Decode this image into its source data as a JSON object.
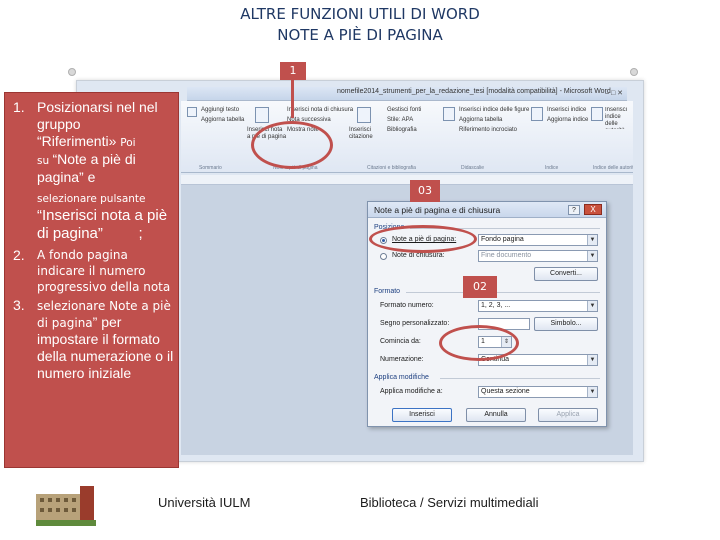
{
  "slide": {
    "title_line1": "ALTRE FUNZIONI UTILI DI WORD",
    "title_line2": "NOTE A PIÈ DI PAGINA"
  },
  "callouts": {
    "c1": "1",
    "c2": "02",
    "c3": "03"
  },
  "steps": [
    {
      "num": "1.",
      "p1": "Posizionarsi nel nel gruppo",
      "p2": "“Riferimenti» ",
      "p2b": "Poi",
      "p3a": "su ",
      "p3b": "“Note a piè di pagina” e",
      "p4a": "selezionare pulsante ",
      "p4b": "“Inserisci nota a piè di pagina”",
      "p4c": ";"
    },
    {
      "num": "2.",
      "p1": "A fondo pagina indicare il numero progressivo della nota"
    },
    {
      "num": "3.",
      "p1a": "selezionare Note a piè di pagina",
      "p1b": "” per impostare il formato della numerazione o il numero iniziale"
    }
  ],
  "word": {
    "title": "nomefile2014_strumenti_per_la_redazione_tesi [modalità compatibilità] - Microsoft Word",
    "ribbon": {
      "items": [
        "Aggiungi testo",
        "Aggiorna tabella",
        "Inserisci nota di chiusura",
        "Nota successiva",
        "Mostra note",
        "Inserisci citazione",
        "Gestisci fonti",
        "Stile: APA",
        "Bibliografia",
        "Inserisci didascalia",
        "Inserisci indice delle figure",
        "Aggiorna tabella",
        "Riferimento incrociato",
        "Contrassegna voce",
        "Inserisci indice",
        "Aggiorna indice",
        "Contrassegna citazione",
        "Inserisci indice delle autorità"
      ],
      "big_buttons": [
        "Inserisci nota a piè di pagina",
        "Inserisci citazione"
      ],
      "groups": [
        "Sommario",
        "Note a piè di pagina",
        "Citazioni e bibliografia",
        "Didascalie",
        "Indice",
        "Indice delle autorità"
      ]
    }
  },
  "dialog": {
    "title": "Note a piè di pagina e di chiusura",
    "help": "?",
    "close": "X",
    "position_label": "Posizione",
    "opt_footnote": "Note a piè di pagina:",
    "opt_endnote": "Note di chiusura:",
    "footnote_value": "Fondo pagina",
    "endnote_value": "Fine documento",
    "convert_btn": "Converti...",
    "format_label": "Formato",
    "number_format_label": "Formato numero:",
    "number_format_value": "1, 2, 3, ...",
    "custom_mark_label": "Segno personalizzato:",
    "symbol_btn": "Simbolo...",
    "start_at_label": "Comincia da:",
    "start_at_value": "1",
    "numbering_label": "Numerazione:",
    "numbering_value": "Continua",
    "apply_changes_label": "Applica modifiche",
    "apply_to_label": "Applica modifiche a:",
    "apply_to_value": "Questa sezione",
    "insert_btn": "Inserisci",
    "cancel_btn": "Annulla",
    "apply_btn": "Applica"
  },
  "footer": {
    "left": "Università IULM",
    "right": "Biblioteca / Servizi multimediali"
  },
  "colors": {
    "accent_red": "#c0504d",
    "title_blue": "#1f3864"
  }
}
